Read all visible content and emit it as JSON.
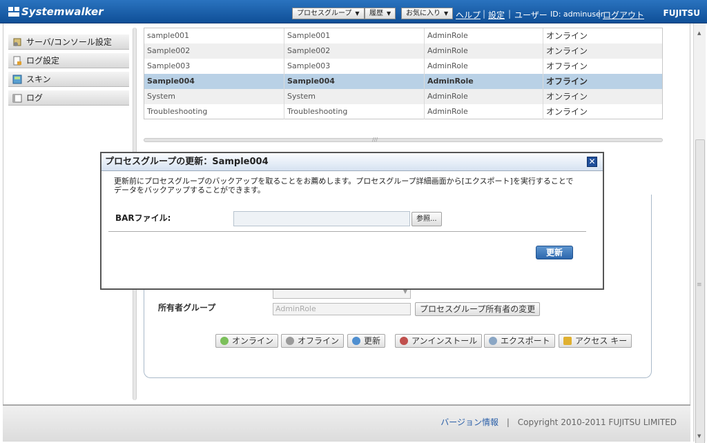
{
  "header": {
    "app_name": "Systemwalker",
    "menu_process_group": "プロセスグループ",
    "menu_history": "履歴",
    "menu_favorites": "お気に入り",
    "link_help": "ヘルプ",
    "link_settings": "設定",
    "user_label": "ユーザー",
    "user_id": "ID: adminuser",
    "link_logout": "ログアウト",
    "brand": "FUJITSU"
  },
  "sidebar": {
    "items": [
      {
        "label": "サーバ/コンソール設定",
        "icon": "server-settings-icon"
      },
      {
        "label": "ログ設定",
        "icon": "log-settings-icon"
      },
      {
        "label": "スキン",
        "icon": "skin-icon"
      },
      {
        "label": "ログ",
        "icon": "log-icon"
      }
    ]
  },
  "table": {
    "rows": [
      {
        "name": "sample001",
        "display": "Sample001",
        "role": "AdminRole",
        "status": "オンライン",
        "selected": false
      },
      {
        "name": "Sample002",
        "display": "Sample002",
        "role": "AdminRole",
        "status": "オンライン",
        "selected": false
      },
      {
        "name": "Sample003",
        "display": "Sample003",
        "role": "AdminRole",
        "status": "オフライン",
        "selected": false
      },
      {
        "name": "Sample004",
        "display": "Sample004",
        "role": "AdminRole",
        "status": "オフライン",
        "selected": true
      },
      {
        "name": "System",
        "display": "System",
        "role": "AdminRole",
        "status": "オンライン",
        "selected": false
      },
      {
        "name": "Troubleshooting",
        "display": "Troubleshooting",
        "role": "AdminRole",
        "status": "オンライン",
        "selected": false
      }
    ]
  },
  "detail": {
    "owner_group_label": "所有者グループ",
    "owner_group_value": "AdminRole",
    "change_owner_button": "プロセスグループ所有者の変更",
    "actions": {
      "online": "オンライン",
      "offline": "オフライン",
      "update": "更新",
      "uninstall": "アンインストール",
      "export": "エクスポート",
      "access_key": "アクセス キー"
    }
  },
  "dialog": {
    "title": "プロセスグループの更新：Sample004",
    "message_line1": "更新前にプロセスグループのバックアップを取ることをお薦めします。プロセスグループ詳細画面から[エクスポート]を実行することで",
    "message_line2": "データをバックアップすることができます。",
    "bar_file_label": "BARファイル:",
    "bar_file_value": "",
    "browse_button": "参照...",
    "update_button": "更新",
    "close_label": "✕"
  },
  "footer": {
    "version_link": "バージョン情報",
    "separator": "|",
    "copyright": "Copyright 2010-2011 FUJITSU LIMITED"
  },
  "colors": {
    "header_blue": "#1a5ea9",
    "selected_row": "#b9d1e6",
    "primary_button": "#2c67ad"
  }
}
